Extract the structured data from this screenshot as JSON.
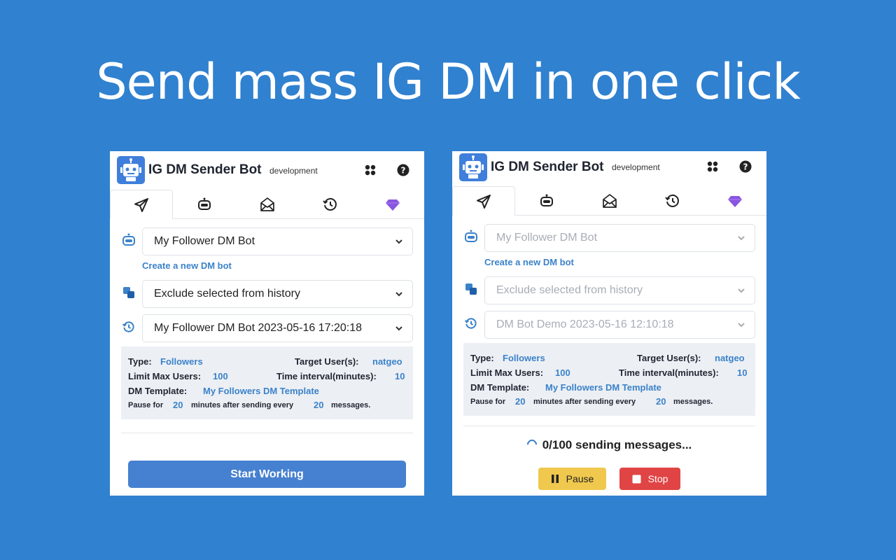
{
  "headline": "Send mass IG DM in one click",
  "colors": {
    "background": "#3081d0",
    "accent": "#3b82c9",
    "gem": "#8a55e0",
    "pause": "#f0c84e",
    "stop": "#e04444"
  },
  "left": {
    "app_title": "IG DM Sender Bot",
    "env": "development",
    "header_icons": [
      "apps-icon",
      "help-icon"
    ],
    "tabs": [
      "send-tab",
      "bot-tab",
      "templates-tab",
      "history-tab",
      "premium-tab"
    ],
    "bot_select": "My Follower DM Bot",
    "create_link": "Create a new DM bot",
    "exclude_select": "Exclude selected from history",
    "history_select": "My Follower DM Bot 2023-05-16 17:20:18",
    "info": {
      "type_label": "Type:",
      "type_value": "Followers",
      "target_label": "Target User(s):",
      "target_value": "natgeo",
      "limit_label": "Limit Max Users:",
      "limit_value": "100",
      "interval_label": "Time interval(minutes):",
      "interval_value": "10",
      "template_label": "DM Template:",
      "template_value": "My Followers DM Template",
      "pause_prefix": "Pause for",
      "pause_minutes": "20",
      "pause_middle": "minutes after sending every",
      "pause_messages": "20",
      "pause_suffix": "messages."
    },
    "start_button": "Start Working"
  },
  "right": {
    "app_title": "IG DM Sender Bot",
    "env": "development",
    "bot_select": "My Follower DM Bot",
    "create_link": "Create a new DM bot",
    "exclude_select": "Exclude selected from history",
    "history_select": "DM Bot Demo 2023-05-16 12:10:18",
    "info": {
      "type_label": "Type:",
      "type_value": "Followers",
      "target_label": "Target User(s):",
      "target_value": "natgeo",
      "limit_label": "Limit Max Users:",
      "limit_value": "100",
      "interval_label": "Time interval(minutes):",
      "interval_value": "10",
      "template_label": "DM Template:",
      "template_value": "My Followers DM Template",
      "pause_prefix": "Pause for",
      "pause_minutes": "20",
      "pause_middle": "minutes after sending every",
      "pause_messages": "20",
      "pause_suffix": "messages."
    },
    "status": "0/100 sending messages...",
    "pause_button": "Pause",
    "stop_button": "Stop"
  }
}
